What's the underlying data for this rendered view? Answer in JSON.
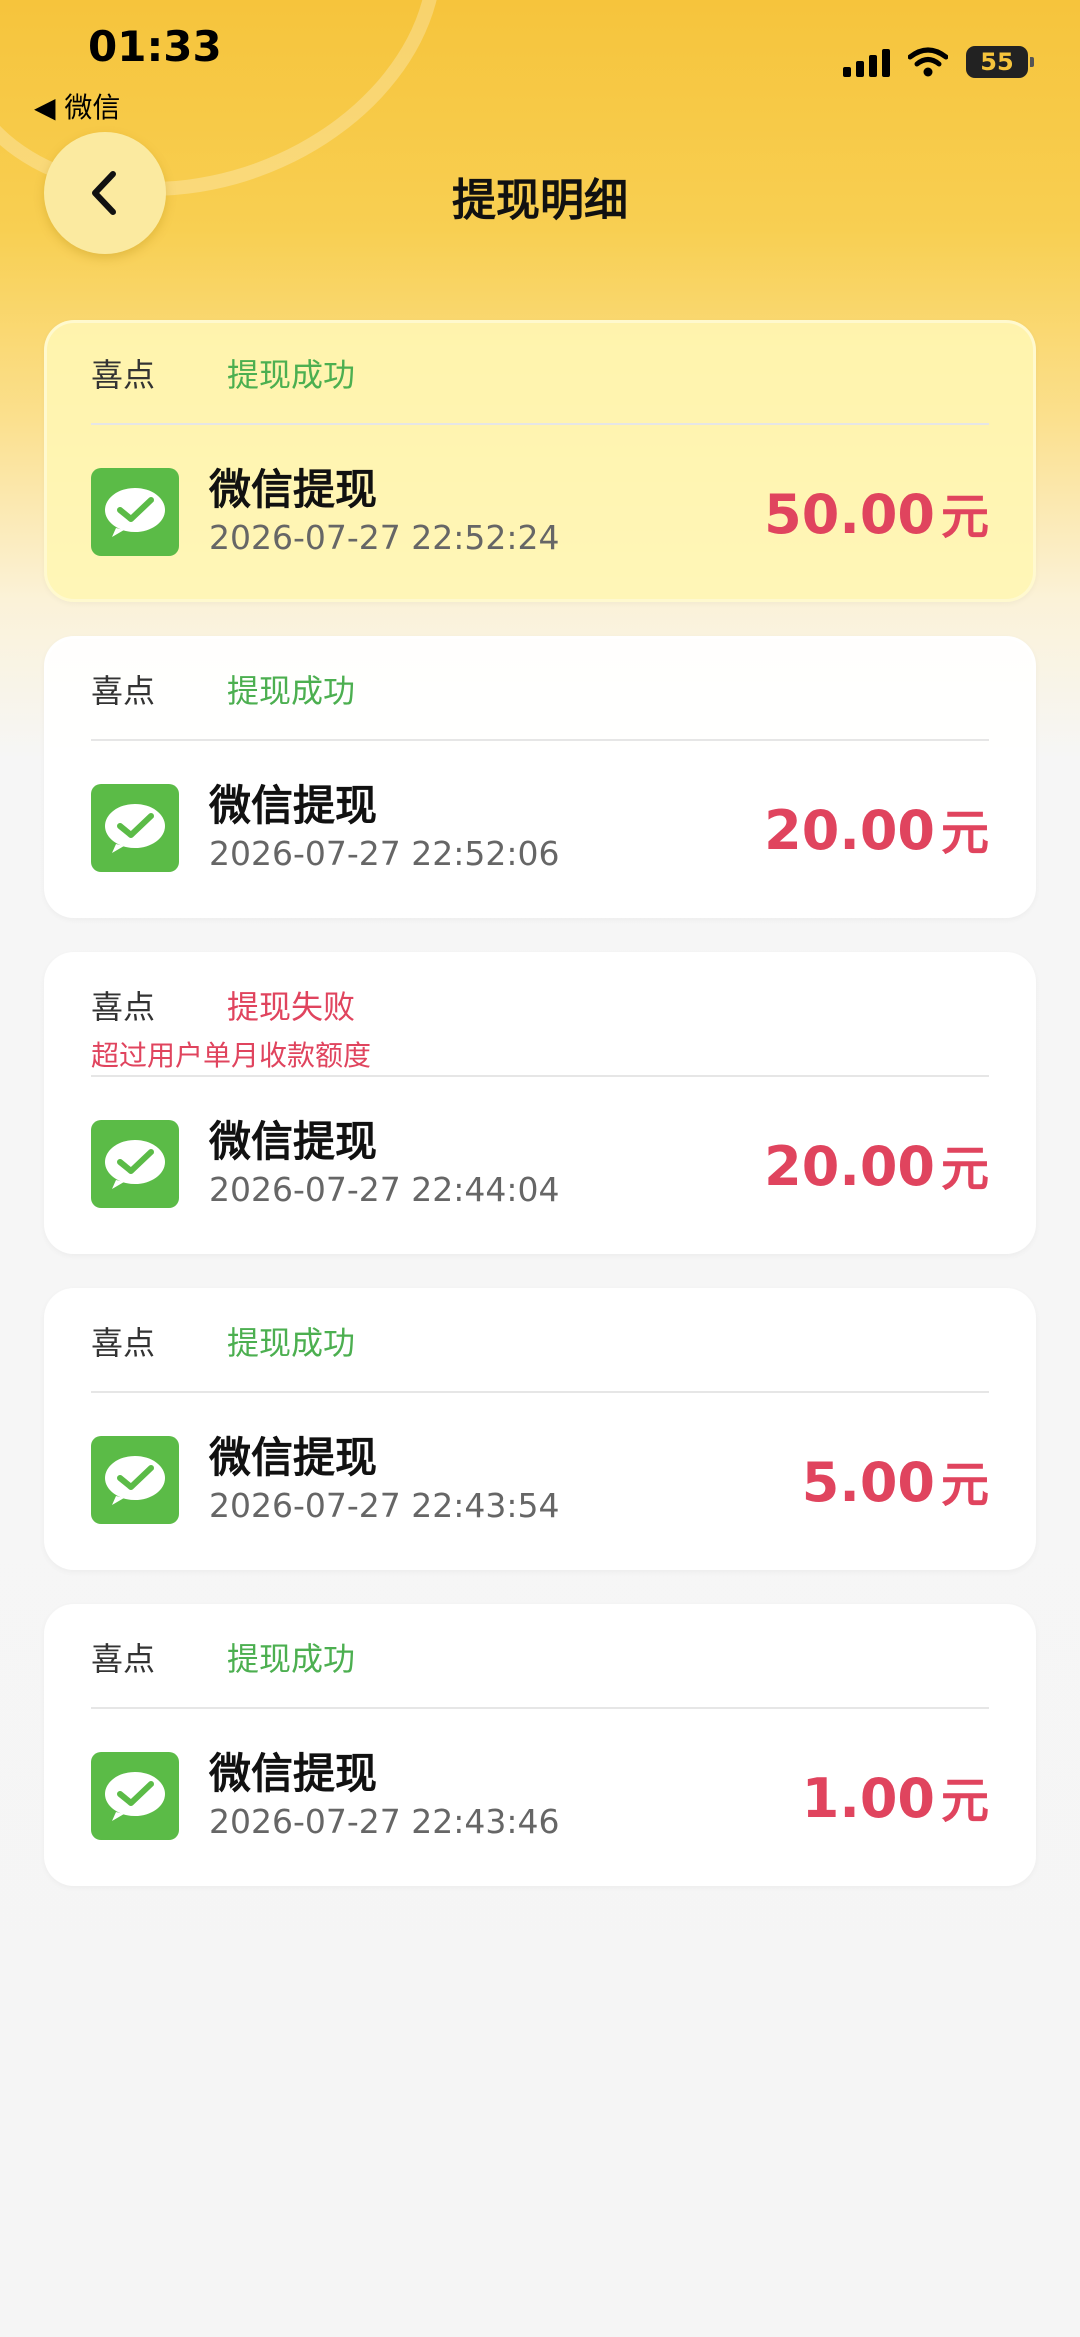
{
  "status_bar": {
    "time": "01:33",
    "back_app_label": "◀ 微信",
    "battery": "55"
  },
  "header": {
    "title": "提现明细",
    "back_icon": "chevron-left-icon"
  },
  "colors": {
    "success": "#4caf50",
    "failure": "#e0445e",
    "amount": "#e0445e",
    "wechat_green": "#5bbb47",
    "header_yellow": "#f6c43c"
  },
  "records": [
    {
      "source": "喜点",
      "status": "提现成功",
      "status_type": "success",
      "reason": "",
      "title": "微信提现",
      "time": "2026-07-27 22:52:24",
      "amount": "50.00",
      "unit": "元"
    },
    {
      "source": "喜点",
      "status": "提现成功",
      "status_type": "success",
      "reason": "",
      "title": "微信提现",
      "time": "2026-07-27 22:52:06",
      "amount": "20.00",
      "unit": "元"
    },
    {
      "source": "喜点",
      "status": "提现失败",
      "status_type": "fail",
      "reason": "超过用户单月收款额度",
      "title": "微信提现",
      "time": "2026-07-27 22:44:04",
      "amount": "20.00",
      "unit": "元"
    },
    {
      "source": "喜点",
      "status": "提现成功",
      "status_type": "success",
      "reason": "",
      "title": "微信提现",
      "time": "2026-07-27 22:43:54",
      "amount": "5.00",
      "unit": "元"
    },
    {
      "source": "喜点",
      "status": "提现成功",
      "status_type": "success",
      "reason": "",
      "title": "微信提现",
      "time": "2026-07-27 22:43:46",
      "amount": "1.00",
      "unit": "元"
    }
  ]
}
